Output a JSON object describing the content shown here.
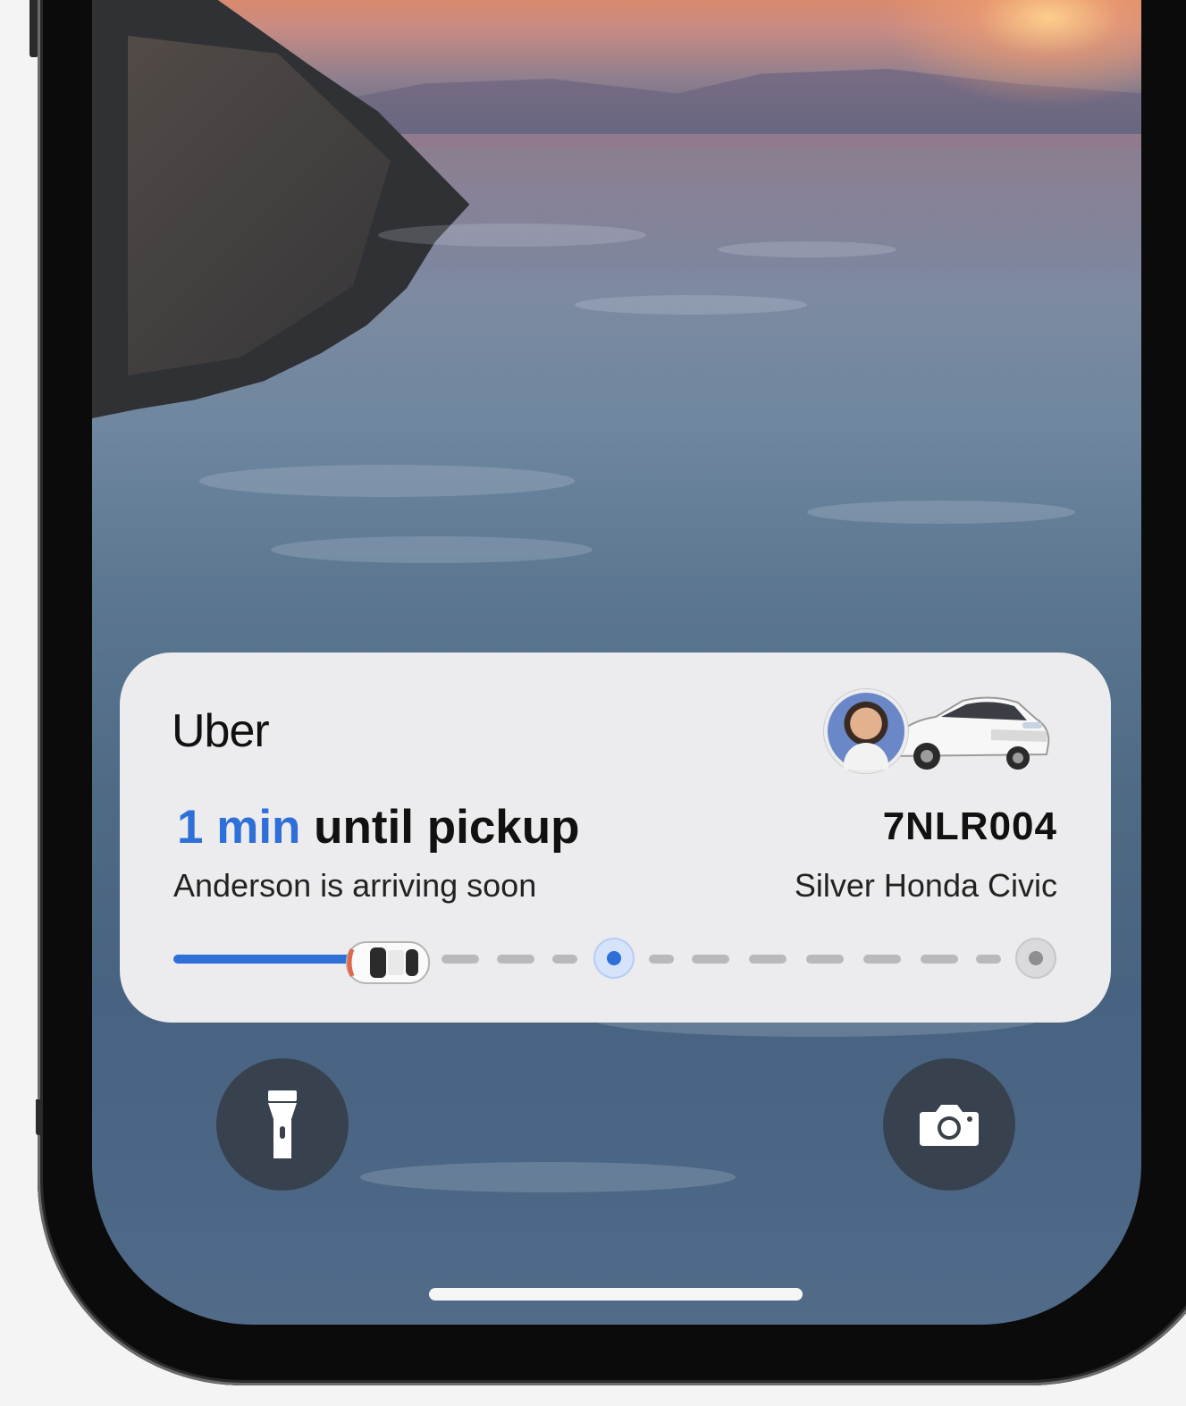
{
  "activity": {
    "app_name": "Uber",
    "eta_value": "1 min",
    "eta_suffix": " until pickup",
    "status_text": "Anderson is arriving soon",
    "license_plate": "7NLR004",
    "vehicle": "Silver Honda Civic",
    "progress_fraction": 0.22
  },
  "lockscreen": {
    "flashlight_icon": "flashlight-icon",
    "camera_icon": "camera-icon"
  },
  "colors": {
    "accent": "#2f6fd8",
    "card": "#ececee",
    "button": "#343a42"
  }
}
